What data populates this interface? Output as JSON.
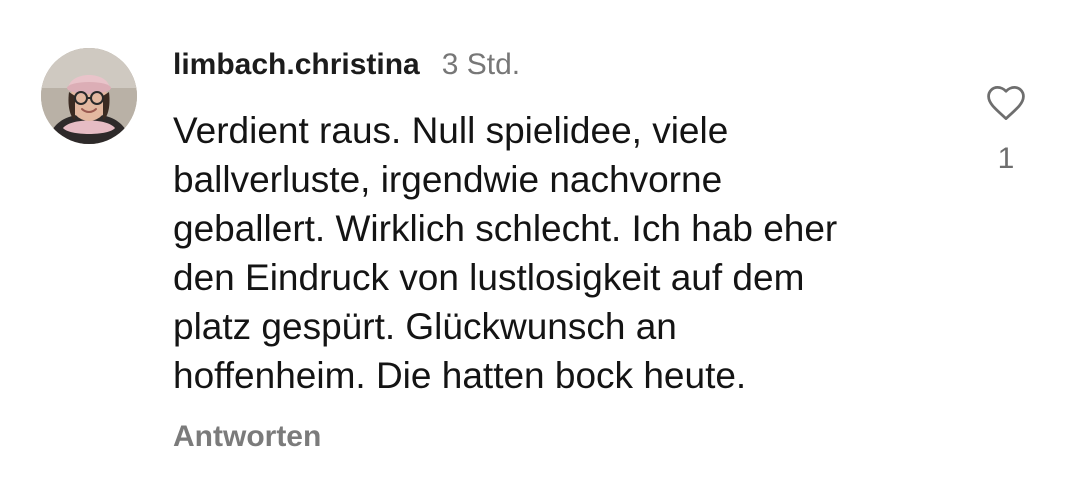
{
  "comment": {
    "username": "limbach.christina",
    "timestamp": "3 Std.",
    "text_lines": [
      "Verdient raus. Null spielidee, viele",
      "ballverluste, irgendwie nachvorne",
      "geballert. Wirklich schlecht. Ich hab eher",
      "den Eindruck von lustlosigkeit auf dem",
      "platz gespürt. Glückwunsch an",
      "hoffenheim. Die hatten bock heute."
    ],
    "reply_label": "Antworten",
    "like_count": "1",
    "like_icon": "heart-outline-icon"
  },
  "colors": {
    "username": "#1c1c1c",
    "secondary": "#777777",
    "reply": "#7b7b7b",
    "like_icon": "#6e6e6e"
  }
}
